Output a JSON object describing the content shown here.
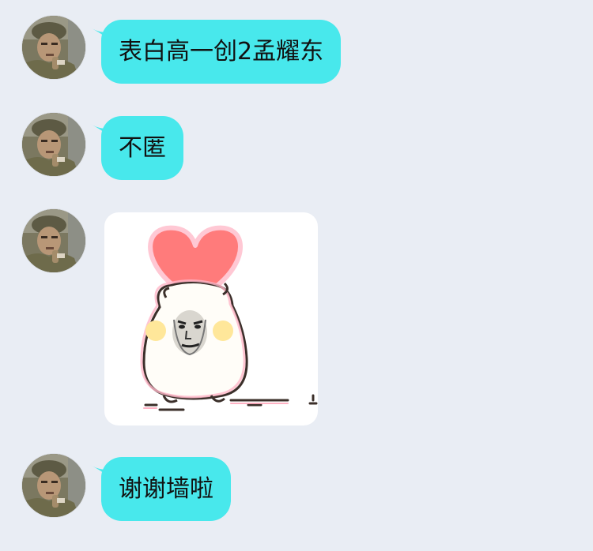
{
  "messages": [
    {
      "type": "text",
      "text": "表白高一创2孟耀东"
    },
    {
      "type": "text",
      "text": "不匿"
    },
    {
      "type": "sticker",
      "icon": "heart-hamster-sticker"
    },
    {
      "type": "text",
      "text": "谢谢墙啦"
    }
  ],
  "colors": {
    "background": "#e9edf4",
    "bubble": "#48e8ec",
    "text": "#111111"
  }
}
